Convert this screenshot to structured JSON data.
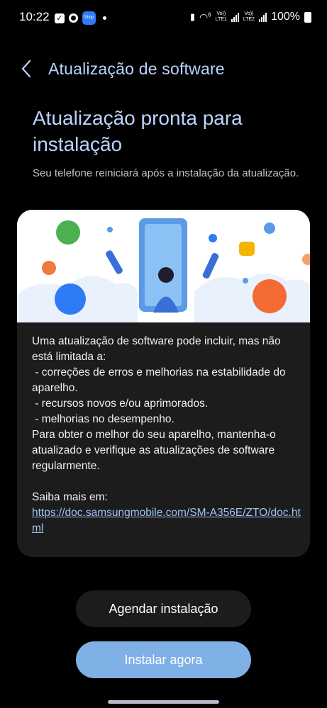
{
  "status_bar": {
    "time": "10:22",
    "shop_label": "Shop",
    "lte1": "LTE1",
    "lte2": "LTE2",
    "volte": "Vo))",
    "wifi_gen": "6",
    "battery": "100%"
  },
  "header": {
    "title": "Atualização de software"
  },
  "main": {
    "headline": "Atualização pronta para instalação",
    "subtext": "Seu telefone reiniciará após a instalação da atualização."
  },
  "card": {
    "description": "Uma atualização de software pode incluir, mas não está limitada a:\n - correções de erros e melhorias na estabilidade do aparelho.\n - recursos novos e/ou aprimorados.\n - melhorias no desempenho.\nPara obter o melhor do seu aparelho, mantenha-o atualizado e verifique as atualizações de software regularmente.",
    "more_label": "Saiba mais em:",
    "link": "https://doc.samsungmobile.com/SM-A356E/ZTO/doc.html"
  },
  "buttons": {
    "schedule": "Agendar instalação",
    "install_now": "Instalar agora"
  },
  "colors": {
    "accent": "#bcd3ff",
    "install_button": "#7fb0e6",
    "link": "#9ec3f3"
  }
}
